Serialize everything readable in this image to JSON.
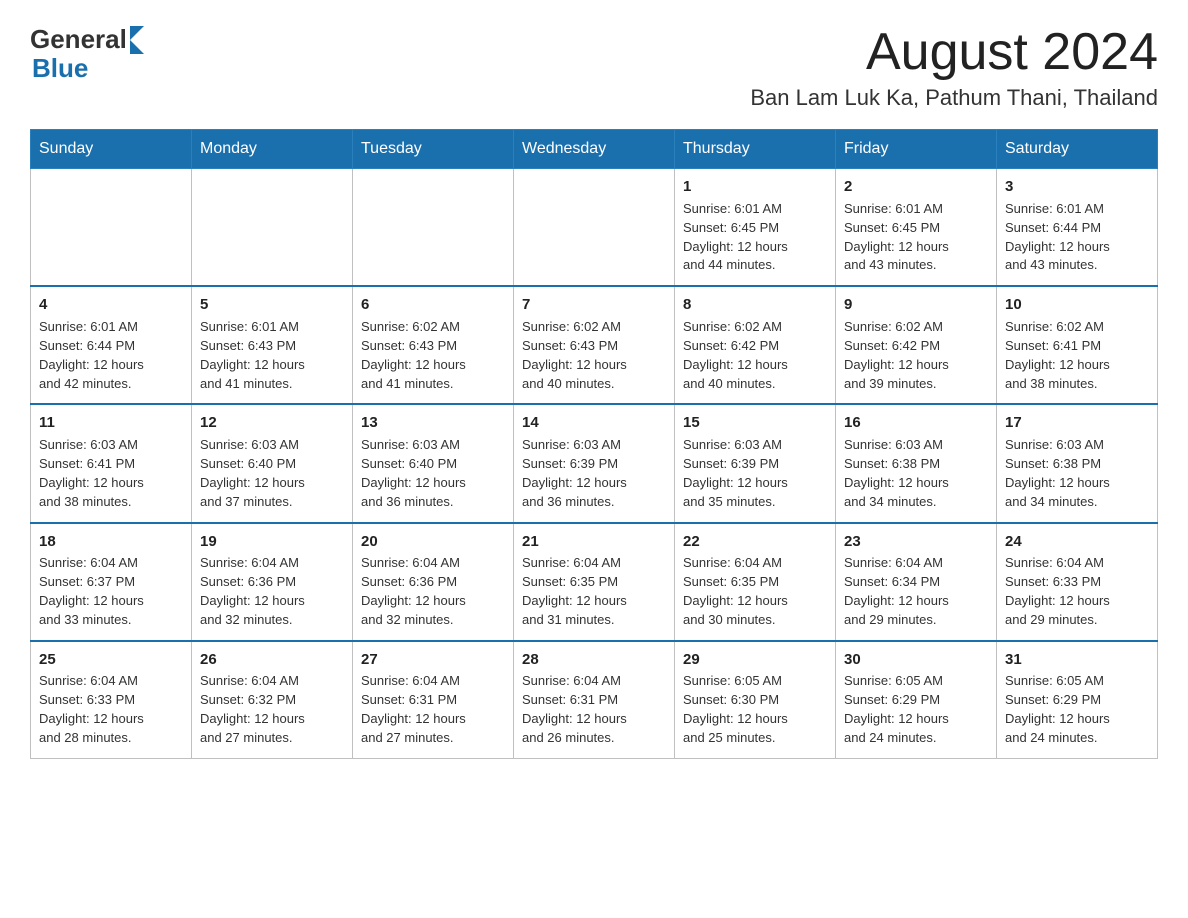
{
  "logo": {
    "general": "General",
    "blue": "Blue"
  },
  "header": {
    "month_year": "August 2024",
    "location": "Ban Lam Luk Ka, Pathum Thani, Thailand"
  },
  "weekdays": [
    "Sunday",
    "Monday",
    "Tuesday",
    "Wednesday",
    "Thursday",
    "Friday",
    "Saturday"
  ],
  "weeks": [
    [
      {
        "day": "",
        "info": ""
      },
      {
        "day": "",
        "info": ""
      },
      {
        "day": "",
        "info": ""
      },
      {
        "day": "",
        "info": ""
      },
      {
        "day": "1",
        "info": "Sunrise: 6:01 AM\nSunset: 6:45 PM\nDaylight: 12 hours\nand 44 minutes."
      },
      {
        "day": "2",
        "info": "Sunrise: 6:01 AM\nSunset: 6:45 PM\nDaylight: 12 hours\nand 43 minutes."
      },
      {
        "day": "3",
        "info": "Sunrise: 6:01 AM\nSunset: 6:44 PM\nDaylight: 12 hours\nand 43 minutes."
      }
    ],
    [
      {
        "day": "4",
        "info": "Sunrise: 6:01 AM\nSunset: 6:44 PM\nDaylight: 12 hours\nand 42 minutes."
      },
      {
        "day": "5",
        "info": "Sunrise: 6:01 AM\nSunset: 6:43 PM\nDaylight: 12 hours\nand 41 minutes."
      },
      {
        "day": "6",
        "info": "Sunrise: 6:02 AM\nSunset: 6:43 PM\nDaylight: 12 hours\nand 41 minutes."
      },
      {
        "day": "7",
        "info": "Sunrise: 6:02 AM\nSunset: 6:43 PM\nDaylight: 12 hours\nand 40 minutes."
      },
      {
        "day": "8",
        "info": "Sunrise: 6:02 AM\nSunset: 6:42 PM\nDaylight: 12 hours\nand 40 minutes."
      },
      {
        "day": "9",
        "info": "Sunrise: 6:02 AM\nSunset: 6:42 PM\nDaylight: 12 hours\nand 39 minutes."
      },
      {
        "day": "10",
        "info": "Sunrise: 6:02 AM\nSunset: 6:41 PM\nDaylight: 12 hours\nand 38 minutes."
      }
    ],
    [
      {
        "day": "11",
        "info": "Sunrise: 6:03 AM\nSunset: 6:41 PM\nDaylight: 12 hours\nand 38 minutes."
      },
      {
        "day": "12",
        "info": "Sunrise: 6:03 AM\nSunset: 6:40 PM\nDaylight: 12 hours\nand 37 minutes."
      },
      {
        "day": "13",
        "info": "Sunrise: 6:03 AM\nSunset: 6:40 PM\nDaylight: 12 hours\nand 36 minutes."
      },
      {
        "day": "14",
        "info": "Sunrise: 6:03 AM\nSunset: 6:39 PM\nDaylight: 12 hours\nand 36 minutes."
      },
      {
        "day": "15",
        "info": "Sunrise: 6:03 AM\nSunset: 6:39 PM\nDaylight: 12 hours\nand 35 minutes."
      },
      {
        "day": "16",
        "info": "Sunrise: 6:03 AM\nSunset: 6:38 PM\nDaylight: 12 hours\nand 34 minutes."
      },
      {
        "day": "17",
        "info": "Sunrise: 6:03 AM\nSunset: 6:38 PM\nDaylight: 12 hours\nand 34 minutes."
      }
    ],
    [
      {
        "day": "18",
        "info": "Sunrise: 6:04 AM\nSunset: 6:37 PM\nDaylight: 12 hours\nand 33 minutes."
      },
      {
        "day": "19",
        "info": "Sunrise: 6:04 AM\nSunset: 6:36 PM\nDaylight: 12 hours\nand 32 minutes."
      },
      {
        "day": "20",
        "info": "Sunrise: 6:04 AM\nSunset: 6:36 PM\nDaylight: 12 hours\nand 32 minutes."
      },
      {
        "day": "21",
        "info": "Sunrise: 6:04 AM\nSunset: 6:35 PM\nDaylight: 12 hours\nand 31 minutes."
      },
      {
        "day": "22",
        "info": "Sunrise: 6:04 AM\nSunset: 6:35 PM\nDaylight: 12 hours\nand 30 minutes."
      },
      {
        "day": "23",
        "info": "Sunrise: 6:04 AM\nSunset: 6:34 PM\nDaylight: 12 hours\nand 29 minutes."
      },
      {
        "day": "24",
        "info": "Sunrise: 6:04 AM\nSunset: 6:33 PM\nDaylight: 12 hours\nand 29 minutes."
      }
    ],
    [
      {
        "day": "25",
        "info": "Sunrise: 6:04 AM\nSunset: 6:33 PM\nDaylight: 12 hours\nand 28 minutes."
      },
      {
        "day": "26",
        "info": "Sunrise: 6:04 AM\nSunset: 6:32 PM\nDaylight: 12 hours\nand 27 minutes."
      },
      {
        "day": "27",
        "info": "Sunrise: 6:04 AM\nSunset: 6:31 PM\nDaylight: 12 hours\nand 27 minutes."
      },
      {
        "day": "28",
        "info": "Sunrise: 6:04 AM\nSunset: 6:31 PM\nDaylight: 12 hours\nand 26 minutes."
      },
      {
        "day": "29",
        "info": "Sunrise: 6:05 AM\nSunset: 6:30 PM\nDaylight: 12 hours\nand 25 minutes."
      },
      {
        "day": "30",
        "info": "Sunrise: 6:05 AM\nSunset: 6:29 PM\nDaylight: 12 hours\nand 24 minutes."
      },
      {
        "day": "31",
        "info": "Sunrise: 6:05 AM\nSunset: 6:29 PM\nDaylight: 12 hours\nand 24 minutes."
      }
    ]
  ]
}
